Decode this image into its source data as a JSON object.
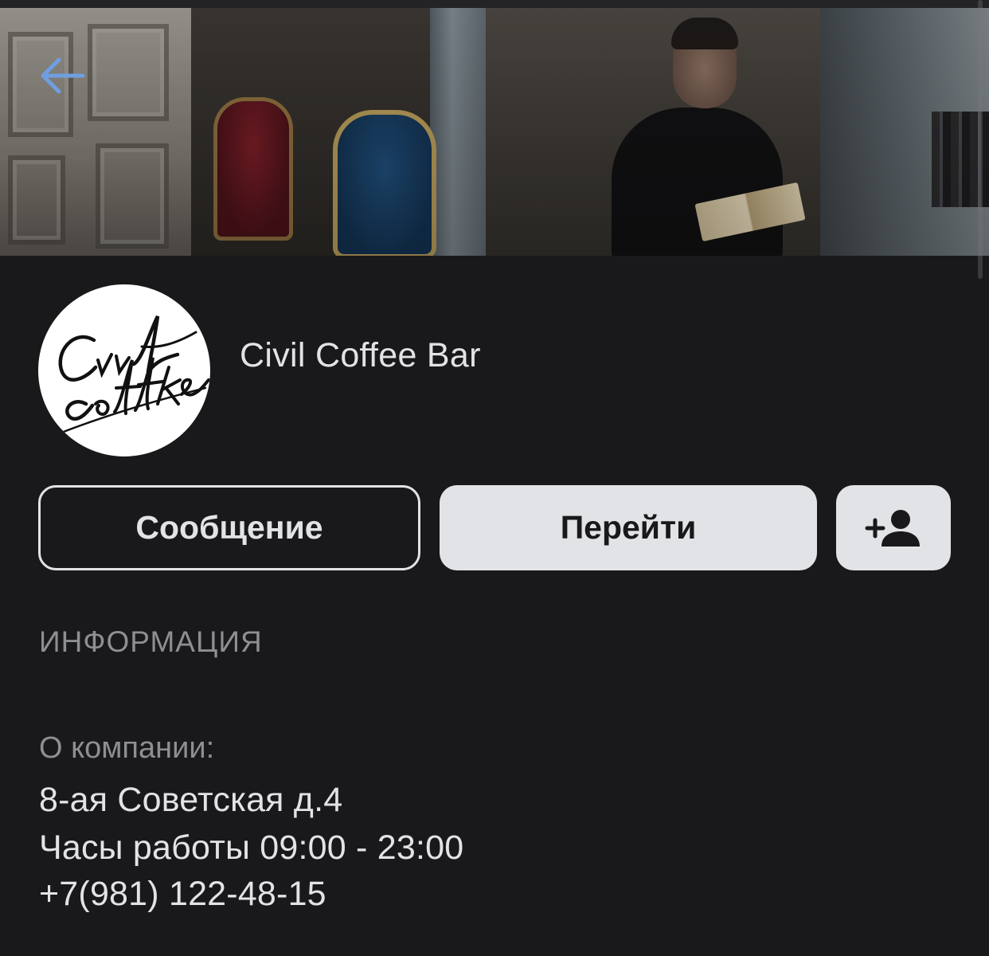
{
  "colors": {
    "background": "#19191b",
    "text_primary": "#e1e3e6",
    "text_secondary": "#8d8f93",
    "accent": "#6f9fe0",
    "button_filled": "#e1e3e6"
  },
  "header": {
    "back_icon": "arrow-left-icon",
    "cover_image": "cafe interior with a woman reading a book"
  },
  "profile": {
    "avatar_logo": "Civil coffee",
    "name": "Civil Coffee Bar"
  },
  "actions": {
    "message_label": "Сообщение",
    "go_label": "Перейти",
    "add_icon": "person-add-icon"
  },
  "info": {
    "section_title": "ИНФОРМАЦИЯ",
    "about_label": "О компании:",
    "lines": [
      "8-ая Советская д.4",
      "Часы работы 09:00 - 23:00",
      "+7(981) 122-48-15"
    ]
  }
}
